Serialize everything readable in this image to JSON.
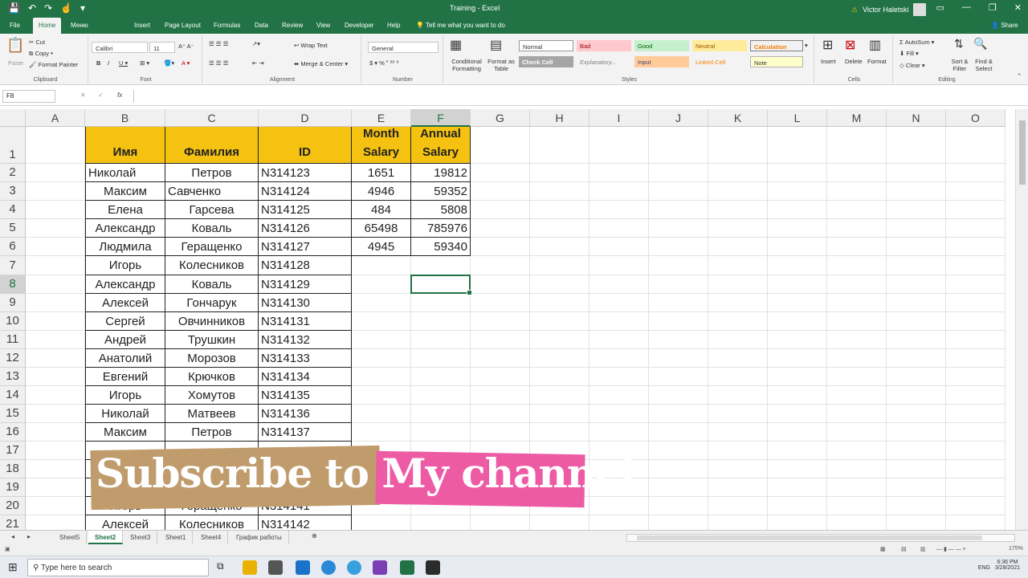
{
  "title": {
    "doc": "Training - Excel",
    "user": "Victor Haletski"
  },
  "tabs": [
    "File",
    "Home",
    "Меню",
    "Insert",
    "Page Layout",
    "Formulas",
    "Data",
    "Review",
    "View",
    "Developer",
    "Help",
    "Tell me what you want to do",
    "Share"
  ],
  "ribbon": {
    "clipboard": {
      "paste": "Paste",
      "cut": "Cut",
      "copy": "Copy",
      "painter": "Format Painter",
      "label": "Clipboard"
    },
    "font": {
      "name": "Calibri",
      "size": "11",
      "label": "Font"
    },
    "alignment": {
      "wrap": "Wrap Text",
      "merge": "Merge & Center",
      "label": "Alignment"
    },
    "number": {
      "format": "General",
      "label": "Number"
    },
    "styles": {
      "cond": "Conditional Formatting",
      "table": "Format as Table",
      "normal": "Normal",
      "bad": "Bad",
      "good": "Good",
      "neutral": "Neutral",
      "calculation": "Calculation",
      "check": "Check Cell",
      "explanatory": "Explanatory...",
      "input": "Input",
      "linked": "Linked Cell",
      "note": "Note",
      "label": "Styles"
    },
    "cells": {
      "insert": "Insert",
      "delete": "Delete",
      "format": "Format",
      "label": "Cells"
    },
    "editing": {
      "autosum": "AutoSum",
      "fill": "Fill",
      "clear": "Clear",
      "sort": "Sort & Filter",
      "find": "Find & Select",
      "label": "Editing"
    }
  },
  "formula_bar": {
    "name_box": "F8",
    "fx": "fx",
    "content": ""
  },
  "columns": [
    "A",
    "B",
    "C",
    "D",
    "E",
    "F",
    "G",
    "H",
    "I",
    "J",
    "K",
    "L",
    "M",
    "N",
    "O"
  ],
  "rows": [
    "1",
    "2",
    "3",
    "4",
    "5",
    "6",
    "7",
    "8",
    "9",
    "10",
    "11",
    "12",
    "13",
    "14",
    "15",
    "16",
    "17",
    "18",
    "19",
    "20",
    "21"
  ],
  "headers": {
    "b": "Имя",
    "c": "Фамилия",
    "d": "ID",
    "e": "Month Salary",
    "f": "Annual Salary"
  },
  "table": [
    {
      "b": "Николай",
      "c": "Петров",
      "d": "N314123",
      "e": "1651",
      "f": "19812"
    },
    {
      "b": "Максим",
      "c": "Савченко",
      "d": "N314124",
      "e": "4946",
      "f": "59352"
    },
    {
      "b": "Елена",
      "c": "Гарсева",
      "d": "N314125",
      "e": "484",
      "f": "5808"
    },
    {
      "b": "Александр",
      "c": "Коваль",
      "d": "N314126",
      "e": "65498",
      "f": "785976"
    },
    {
      "b": "Людмила",
      "c": "Геращенко",
      "d": "N314127",
      "e": "4945",
      "f": "59340"
    },
    {
      "b": "Игорь",
      "c": "Колесников",
      "d": "N314128"
    },
    {
      "b": "Александр",
      "c": "Коваль",
      "d": "N314129"
    },
    {
      "b": "Алексей",
      "c": "Гончарук",
      "d": "N314130"
    },
    {
      "b": "Сергей",
      "c": "Овчинников",
      "d": "N314131"
    },
    {
      "b": "Андрей",
      "c": "Трушкин",
      "d": "N314132"
    },
    {
      "b": "Анатолий",
      "c": "Морозов",
      "d": "N314133"
    },
    {
      "b": "Евгений",
      "c": "Крючков",
      "d": "N314134"
    },
    {
      "b": "Игорь",
      "c": "Хомутов",
      "d": "N314135"
    },
    {
      "b": "Николай",
      "c": "Матвеев",
      "d": "N314136"
    },
    {
      "b": "Максим",
      "c": "Петров",
      "d": "N314137"
    },
    {
      "b": "",
      "c": "",
      "d": ""
    },
    {
      "b": "",
      "c": "",
      "d": ""
    },
    {
      "b": "",
      "c": "",
      "d": ""
    },
    {
      "b": "Игорь",
      "c": "Геращенко",
      "d": "N314141"
    },
    {
      "b": "Алексей",
      "c": "Колесников",
      "d": "N314142"
    }
  ],
  "sheets": [
    "Sheet5",
    "Sheet2",
    "Sheet3",
    "Sheet1",
    "Sheet4",
    "График работы"
  ],
  "active_sheet": "Sheet2",
  "overlay_text": "Subscribe to My channel",
  "status": {
    "zoom": "175%"
  },
  "taskbar": {
    "search": "Type here to search",
    "time": "6:36 PM",
    "date": "3/28/2021",
    "lang": "ENG"
  },
  "colors": {
    "excel_green": "#217346",
    "header_fill": "#f5c211",
    "overlay_tan": "#c09c6d",
    "overlay_pink": "#ee5ba5"
  }
}
